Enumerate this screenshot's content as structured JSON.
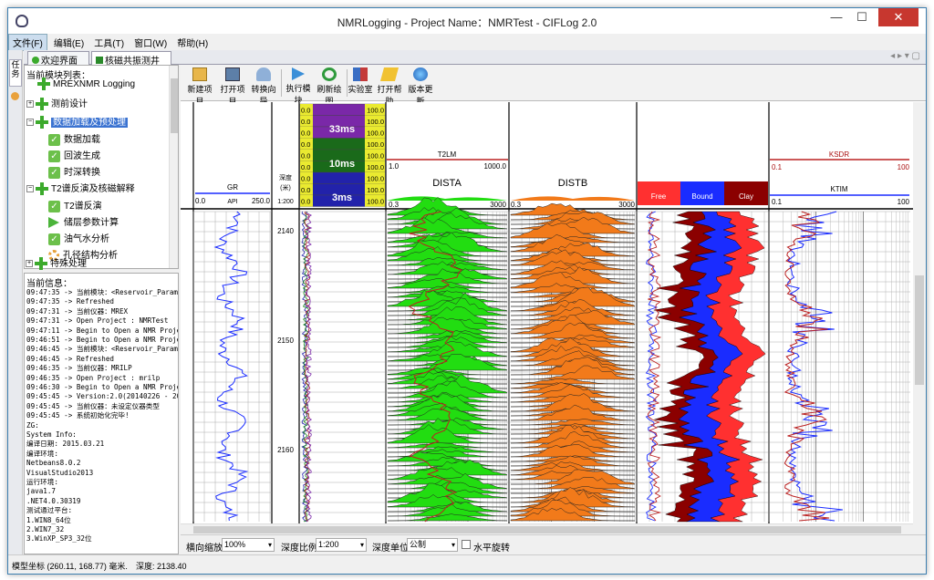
{
  "window": {
    "title": "NMRLogging - Project Name：NMRTest - CIFLog 2.0",
    "min": "—",
    "max": "☐",
    "close": "✕"
  },
  "menu": [
    "文件(F)",
    "编辑(E)",
    "工具(T)",
    "窗口(W)",
    "帮助(H)"
  ],
  "side_tab": "任务",
  "tabs": [
    {
      "label": "欢迎界面",
      "close": "×"
    },
    {
      "label": "核磁共振测井",
      "close": "×"
    }
  ],
  "tab_nav": "◂ ▸ ▾ ▢",
  "tree": {
    "header": "当前模块列表：",
    "items": [
      {
        "label": "MREXNMR Logging",
        "icon": "plus-icon"
      },
      {
        "label": "测前设计",
        "icon": "plus-icon",
        "expander": "+"
      },
      {
        "label": "数据加载及预处理",
        "icon": "plus-icon",
        "expander": "−",
        "selected": true
      },
      {
        "label": "数据加载",
        "icon": "check-icon"
      },
      {
        "label": "回波生成",
        "icon": "check-icon"
      },
      {
        "label": "时深转换",
        "icon": "check-icon"
      },
      {
        "label": "T2谱反演及核磁解释",
        "icon": "plus-icon",
        "expander": "−"
      },
      {
        "label": "T2谱反演",
        "icon": "check-icon"
      },
      {
        "label": "储层参数计算",
        "icon": "arrow-icon"
      },
      {
        "label": "油气水分析",
        "icon": "check-icon"
      },
      {
        "label": "孔径结构分析",
        "icon": "gear-icon"
      },
      {
        "label": "特殊处理",
        "icon": "plus-icon",
        "expander": "+"
      }
    ]
  },
  "info": {
    "header": "当前信息：",
    "lines": [
      "09:47:35 -> 当前模块：<Reservoir_Param",
      "09:47:35 -> Refreshed",
      "09:47:31 -> 当前仪器：MREX",
      "09:47:31 -> Open Project : NMRTest",
      "09:47:11 -> Begin to Open a NMR Proje",
      "09:46:51 -> Begin to Open a NMR Proje",
      "09:46:45 -> 当前模块：<Reservoir_Param",
      "09:46:45 -> Refreshed",
      "09:46:35 -> 当前仪器：MRILP",
      "09:46:35 -> Open Project : mrilp",
      "09:46:30 -> Begin to Open a NMR Proje",
      "09:45:45 -> Version:2.0(20140226 - 20",
      "09:45:45 -> 当前仪器：未设定仪器类型",
      "09:45:45 -> 系统初始化完毕!",
      "         ZG:",
      "System Info:",
      "编译日期: 2015.03.21",
      "编译环境:",
      "        Netbeans8.0.2",
      "        VisualStudio2013",
      "运行环境:",
      "        java1.7",
      "        .NET4.0.30319",
      "测试通过平台:",
      "        1.WIN8_64位",
      "        2.WIN7_32",
      "        3.WinXP_SP3_32位"
    ]
  },
  "toolbar": [
    {
      "label": "新建项目",
      "icon": "new-project-icon"
    },
    {
      "label": "打开项目",
      "icon": "open-project-icon"
    },
    {
      "label": "转换向导",
      "icon": "convert-wizard-icon"
    },
    {
      "label": "执行模块",
      "icon": "run-module-icon"
    },
    {
      "label": "刷新绘图",
      "icon": "refresh-plot-icon"
    },
    {
      "label": "实验室",
      "icon": "lab-icon"
    },
    {
      "label": "打开帮助",
      "icon": "help-icon"
    },
    {
      "label": "版本更新",
      "icon": "update-icon"
    }
  ],
  "tracks": {
    "gr": {
      "name": "GR",
      "unit": "API",
      "min": "0.0",
      "max": "250.0"
    },
    "depth": {
      "label1": "深度",
      "label2": "(米)",
      "scale": "1:200",
      "ticks": [
        "2140",
        "2150",
        "2160"
      ]
    },
    "echo": {
      "values": [
        "0.0",
        "0.0",
        "0.0",
        "0.0",
        "0.0",
        "0.0",
        "0.0",
        "0.0",
        "0.0"
      ],
      "values_right": [
        "100.0",
        "100.0",
        "100.0",
        "100.0",
        "100.0",
        "100.0",
        "100.0",
        "100.0",
        "100.0"
      ],
      "labels": [
        "33ms",
        "10ms",
        "3ms"
      ]
    },
    "t2lm": {
      "name": "T2LM",
      "min": "1.0",
      "max": "1000.0"
    },
    "dista": {
      "name": "DISTA",
      "min": "0.3",
      "max": "3000"
    },
    "distb": {
      "name": "DISTB",
      "min": "0.3",
      "max": "3000"
    },
    "fluid": {
      "labels": [
        "Free",
        "Bound",
        "Clay"
      ]
    },
    "ksdr": {
      "name": "KSDR",
      "min": "0.1",
      "max": "100"
    },
    "ktim": {
      "name": "KTIM",
      "min": "0.1",
      "max": "100"
    }
  },
  "options": {
    "h_scale_label": "横向缩放:",
    "h_scale_value": "100%",
    "depth_scale_label": "深度比例:",
    "depth_scale_value": "1:200",
    "depth_unit_label": "深度单位:",
    "depth_unit_value": "公制",
    "rotate_label": "水平旋转"
  },
  "status": {
    "coord": "模型坐标 (260.11, 168.77) 毫米.",
    "depth": "深度: 2138.40"
  },
  "colors": {
    "free": "#ff3030",
    "bound": "#1a2cff",
    "clay": "#8b0000",
    "dista": "#22dd11",
    "distb": "#f27a1a",
    "selected": "#3b73d1"
  }
}
